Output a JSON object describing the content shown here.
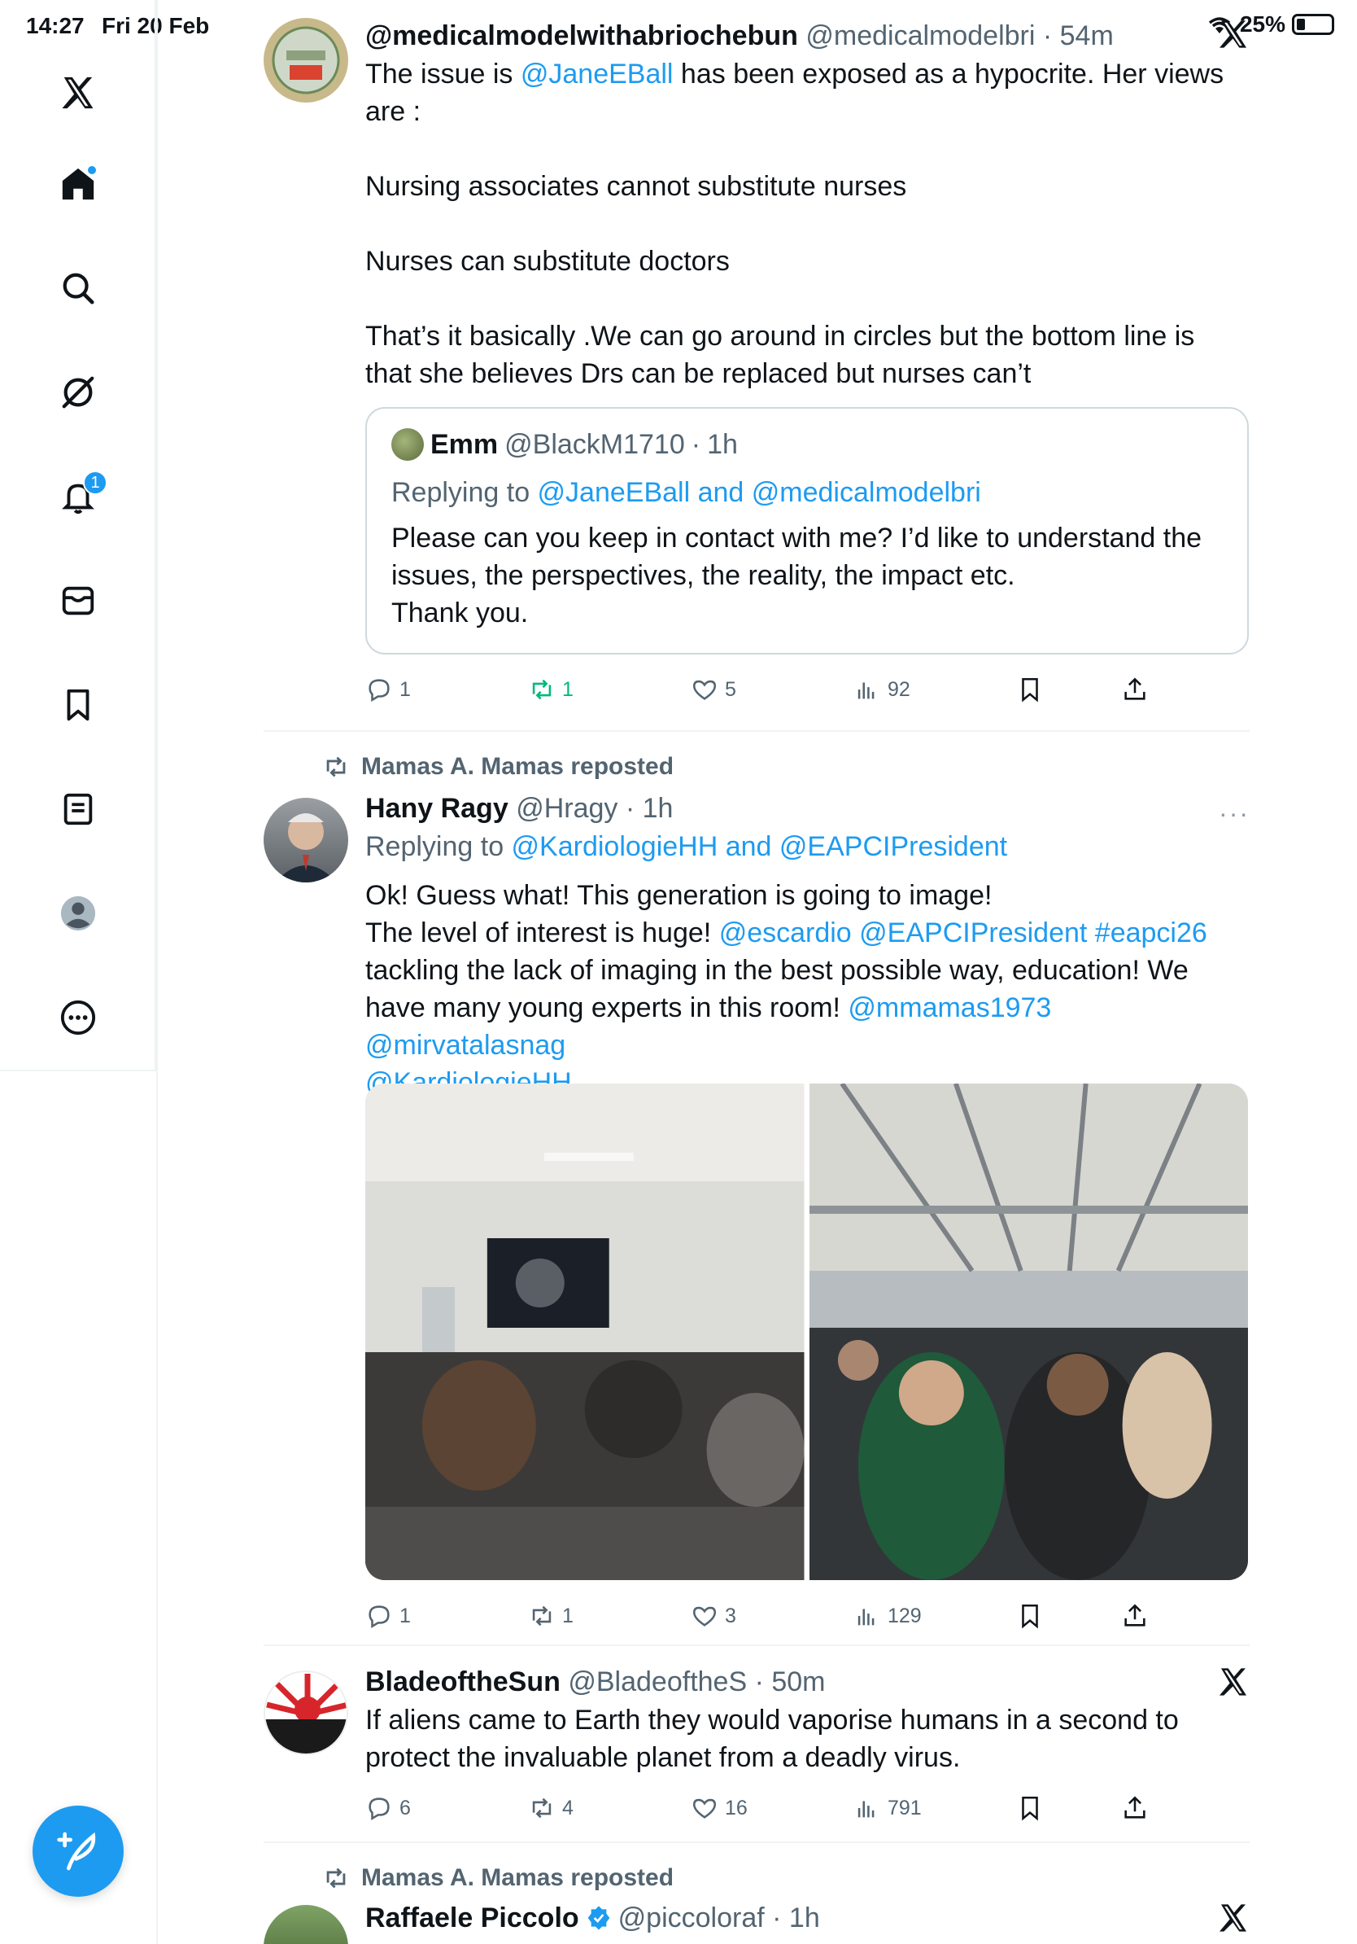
{
  "status": {
    "time": "14:27",
    "date": "Fri 20 Feb",
    "battery": "25%"
  },
  "sidebar": {
    "items": [
      {
        "name": "x-logo"
      },
      {
        "name": "home"
      },
      {
        "name": "search"
      },
      {
        "name": "grok"
      },
      {
        "name": "notifications",
        "badge": "1"
      },
      {
        "name": "messages"
      },
      {
        "name": "bookmarks"
      },
      {
        "name": "lists"
      },
      {
        "name": "profile"
      },
      {
        "name": "more"
      }
    ]
  },
  "tweets": [
    {
      "name": "@medicalmodelwithabriochebun",
      "handle": "@medicalmodelbri",
      "time": "54m",
      "text_intro": "The issue is ",
      "mention": "@JaneEBall",
      "text_rest": " has been exposed as a hypocrite. Her views are :",
      "p2": "Nursing associates cannot substitute nurses",
      "p3": "Nurses can substitute doctors",
      "p4": "That’s it basically .We can go around in circles but the bottom line is that she believes Drs can be replaced but nurses can’t",
      "quote": {
        "name": "Emm",
        "handle": "@BlackM1710",
        "time": "1h",
        "replying_prefix": "Replying to ",
        "replying_to": "@JaneEBall and @medicalmodelbri",
        "line1": "Please can you keep in contact with me? I’d like to understand the issues, the perspectives, the reality, the impact etc.",
        "line2": "Thank you."
      },
      "stats": {
        "replies": "1",
        "reposts": "1",
        "likes": "5",
        "views": "92"
      }
    },
    {
      "reposted_by": "Mamas A. Mamas reposted",
      "name": "Hany Ragy",
      "handle": "@Hragy",
      "time": "1h",
      "more": "···",
      "replying_prefix": "Replying to ",
      "replying_to": "@KardiologieHH and @EAPCIPresident",
      "line1": "Ok! Guess what! This generation is going to image!",
      "line2_a": "The level of interest is huge! ",
      "line2_links": "@escardio @EAPCIPresident #eapci26",
      "line3": "tackling the lack of imaging in the best possible way, education! We have many young experts in this room! ",
      "line3_links": "@mmamas1973 @mirvatalasnag",
      "line4_link": "@KardiologieHH",
      "stats": {
        "replies": "1",
        "reposts": "1",
        "likes": "3",
        "views": "129"
      }
    },
    {
      "name": "BladeoftheSun",
      "handle": "@BladeoftheS",
      "time": "50m",
      "text": "If aliens came to Earth they would vaporise humans in a second to protect the invaluable planet from a deadly virus.",
      "stats": {
        "replies": "6",
        "reposts": "4",
        "likes": "16",
        "views": "791"
      }
    },
    {
      "reposted_by": "Mamas A. Mamas reposted",
      "name": "Raffaele Piccolo",
      "handle": "@piccoloraf",
      "time": "1h"
    }
  ],
  "separator": " · "
}
